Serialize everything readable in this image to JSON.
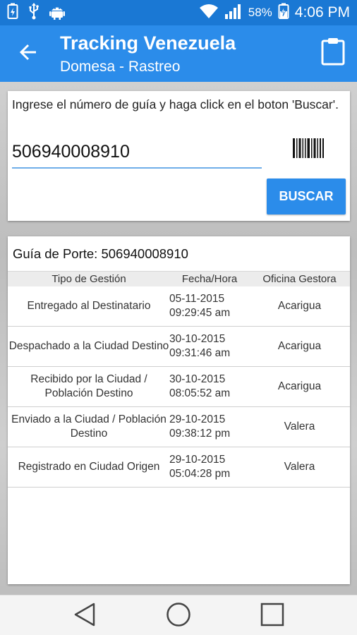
{
  "status_bar": {
    "battery_percent": "58%",
    "time": "4:06 PM",
    "icons": [
      "battery-saver-icon",
      "usb-icon",
      "android-icon",
      "wifi-icon",
      "signal-icon",
      "battery-charging-icon"
    ]
  },
  "app_bar": {
    "title": "Tracking Venezuela",
    "subtitle": "Domesa - Rastreo",
    "back_icon": "arrow-back-icon",
    "action_icon": "clipboard-icon"
  },
  "search": {
    "instructions": "Ingrese el número de guía y haga click en el boton 'Buscar'.",
    "tracking_number": "506940008910",
    "scan_icon": "barcode-icon",
    "button_label": "BUSCAR"
  },
  "results": {
    "heading": "Guía de Porte: 506940008910",
    "columns": [
      "Tipo de Gestión",
      "Fecha/Hora",
      "Oficina Gestora"
    ],
    "rows": [
      {
        "tipo": "Entregado al Destinatario",
        "fecha": "05-11-2015",
        "hora": "09:29:45 am",
        "oficina": "Acarigua"
      },
      {
        "tipo": "Despachado a la Ciudad Destino",
        "fecha": "30-10-2015",
        "hora": "09:31:46 am",
        "oficina": "Acarigua"
      },
      {
        "tipo": "Recibido por la Ciudad / Población Destino",
        "fecha": "30-10-2015",
        "hora": "08:05:52 am",
        "oficina": "Acarigua"
      },
      {
        "tipo": "Enviado a la Ciudad / Población Destino",
        "fecha": "29-10-2015",
        "hora": "09:38:12 pm",
        "oficina": "Valera"
      },
      {
        "tipo": "Registrado en Ciudad Origen",
        "fecha": "29-10-2015",
        "hora": "05:04:28 pm",
        "oficina": "Valera"
      }
    ]
  },
  "colors": {
    "status_bar": "#1a78d4",
    "app_bar": "#2b8cea",
    "accent": "#2b8cea",
    "input_underline": "#6faee9"
  },
  "nav_bar": {
    "icons": [
      "nav-back-icon",
      "nav-home-icon",
      "nav-recents-icon"
    ]
  }
}
